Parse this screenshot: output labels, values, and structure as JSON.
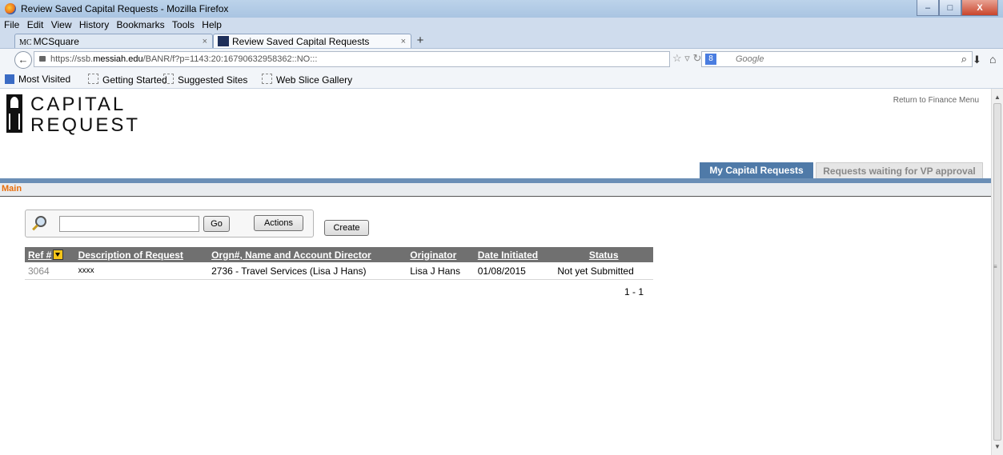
{
  "window": {
    "title": "Review Saved Capital Requests - Mozilla Firefox",
    "min_label": "–",
    "max_label": "□",
    "close_label": "X"
  },
  "menu": [
    "File",
    "Edit",
    "View",
    "History",
    "Bookmarks",
    "Tools",
    "Help"
  ],
  "tabs": [
    {
      "favicon_text": "MC",
      "label": "MCSquare"
    },
    {
      "label": "Review Saved Capital Requests"
    }
  ],
  "new_tab_label": "+",
  "address": {
    "url_prefix": "https://ssb.",
    "url_domain": "messiah.edu",
    "url_path": "/BANR/f?p=1143:20:16790632958362::NO:::"
  },
  "search": {
    "placeholder": "Google",
    "engine_letter": "8"
  },
  "bookmarks": [
    "Most Visited",
    "Getting Started",
    "Suggested Sites",
    "Web Slice Gallery"
  ],
  "app": {
    "logo_line1": "CAPITAL",
    "logo_line2": "REQUEST",
    "return_link": "Return to Finance Menu",
    "tabs": [
      "My Capital Requests",
      "Requests waiting for VP approval"
    ],
    "breadcrumb": "Main",
    "toolbar": {
      "go_label": "Go",
      "actions_label": "Actions",
      "create_label": "Create",
      "search_value": ""
    },
    "table": {
      "columns": [
        "Ref #",
        "Description of Request",
        "Orgn#, Name and Account Director",
        "Originator",
        "Date Initiated",
        "Status"
      ],
      "rows": [
        {
          "ref": "3064",
          "description": "xxxx",
          "orgn": "2736 - Travel Services (Lisa J Hans)",
          "originator": "Lisa J Hans",
          "date": "01/08/2015",
          "status": "Not yet Submitted"
        }
      ],
      "pagination": "1 - 1"
    }
  }
}
